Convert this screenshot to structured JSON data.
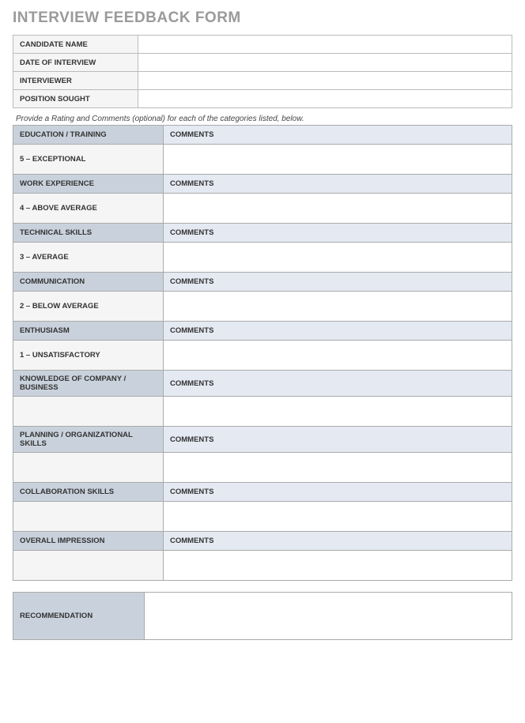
{
  "title": "INTERVIEW FEEDBACK FORM",
  "info": {
    "candidate_name_label": "CANDIDATE NAME",
    "candidate_name_value": "",
    "date_label": "DATE OF INTERVIEW",
    "date_value": "",
    "interviewer_label": "INTERVIEWER",
    "interviewer_value": "",
    "position_label": "POSITION SOUGHT",
    "position_value": ""
  },
  "instruction": "Provide a Rating and Comments (optional) for each of the categories listed, below.",
  "comments_header": "COMMENTS",
  "sections": [
    {
      "category": "EDUCATION / TRAINING",
      "rating": "5 – EXCEPTIONAL",
      "comment": ""
    },
    {
      "category": "WORK EXPERIENCE",
      "rating": "4 – ABOVE AVERAGE",
      "comment": ""
    },
    {
      "category": "TECHNICAL SKILLS",
      "rating": "3 – AVERAGE",
      "comment": ""
    },
    {
      "category": "COMMUNICATION",
      "rating": "2 – BELOW AVERAGE",
      "comment": ""
    },
    {
      "category": "ENTHUSIASM",
      "rating": "1 – UNSATISFACTORY",
      "comment": ""
    },
    {
      "category": "KNOWLEDGE OF COMPANY / BUSINESS",
      "rating": "",
      "comment": ""
    },
    {
      "category": "PLANNING / ORGANIZATIONAL SKILLS",
      "rating": "",
      "comment": ""
    },
    {
      "category": "COLLABORATION SKILLS",
      "rating": "",
      "comment": ""
    },
    {
      "category": "OVERALL IMPRESSION",
      "rating": "",
      "comment": ""
    }
  ],
  "recommendation": {
    "label": "RECOMMENDATION",
    "value": ""
  }
}
